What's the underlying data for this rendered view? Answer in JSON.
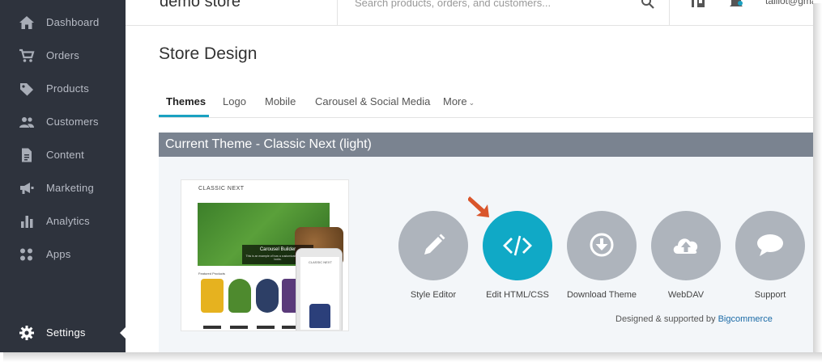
{
  "header": {
    "store_name": "demo store",
    "search_placeholder": "Search products, orders, and customers...",
    "user_text": "talliot@gmail.com"
  },
  "sidebar": {
    "items": [
      {
        "label": "Dashboard",
        "icon": "home-icon"
      },
      {
        "label": "Orders",
        "icon": "cart-icon"
      },
      {
        "label": "Products",
        "icon": "tag-icon"
      },
      {
        "label": "Customers",
        "icon": "people-icon"
      },
      {
        "label": "Content",
        "icon": "document-icon"
      },
      {
        "label": "Marketing",
        "icon": "megaphone-icon"
      },
      {
        "label": "Analytics",
        "icon": "bar-chart-icon"
      },
      {
        "label": "Apps",
        "icon": "grid-dots-icon"
      }
    ],
    "settings": {
      "label": "Settings",
      "icon": "gear-icon",
      "active": true
    }
  },
  "page": {
    "title": "Store Design",
    "tabs": [
      {
        "label": "Themes",
        "active": true
      },
      {
        "label": "Logo"
      },
      {
        "label": "Mobile"
      },
      {
        "label": "Carousel & Social Media"
      },
      {
        "label": "More"
      }
    ]
  },
  "theme": {
    "bar_title": "Current Theme - Classic Next (light)",
    "preview": {
      "logo": "CLASSIC NEXT",
      "banner_title": "Carousel Builder",
      "banner_text": "This is an example of how a customizable carousel looks.",
      "featured": "Featured Products",
      "mobile_logo": "CLASSIC NEXT"
    },
    "actions": [
      {
        "label": "Style Editor",
        "icon": "pencil-icon",
        "primary": false
      },
      {
        "label": "Edit HTML/CSS",
        "icon": "code-icon",
        "primary": true
      },
      {
        "label": "Download Theme",
        "icon": "download-icon",
        "primary": false
      },
      {
        "label": "WebDAV",
        "icon": "cloud-upload-icon",
        "primary": false
      },
      {
        "label": "Support",
        "icon": "chat-bubble-icon",
        "primary": false
      }
    ],
    "credit_prefix": "Designed & supported by",
    "credit_link": "Bigcommerce"
  },
  "colors": {
    "sidebar_bg": "#2e333d",
    "accent": "#10a9c6",
    "theme_bar": "#7a8390",
    "arrow": "#d9552b"
  }
}
